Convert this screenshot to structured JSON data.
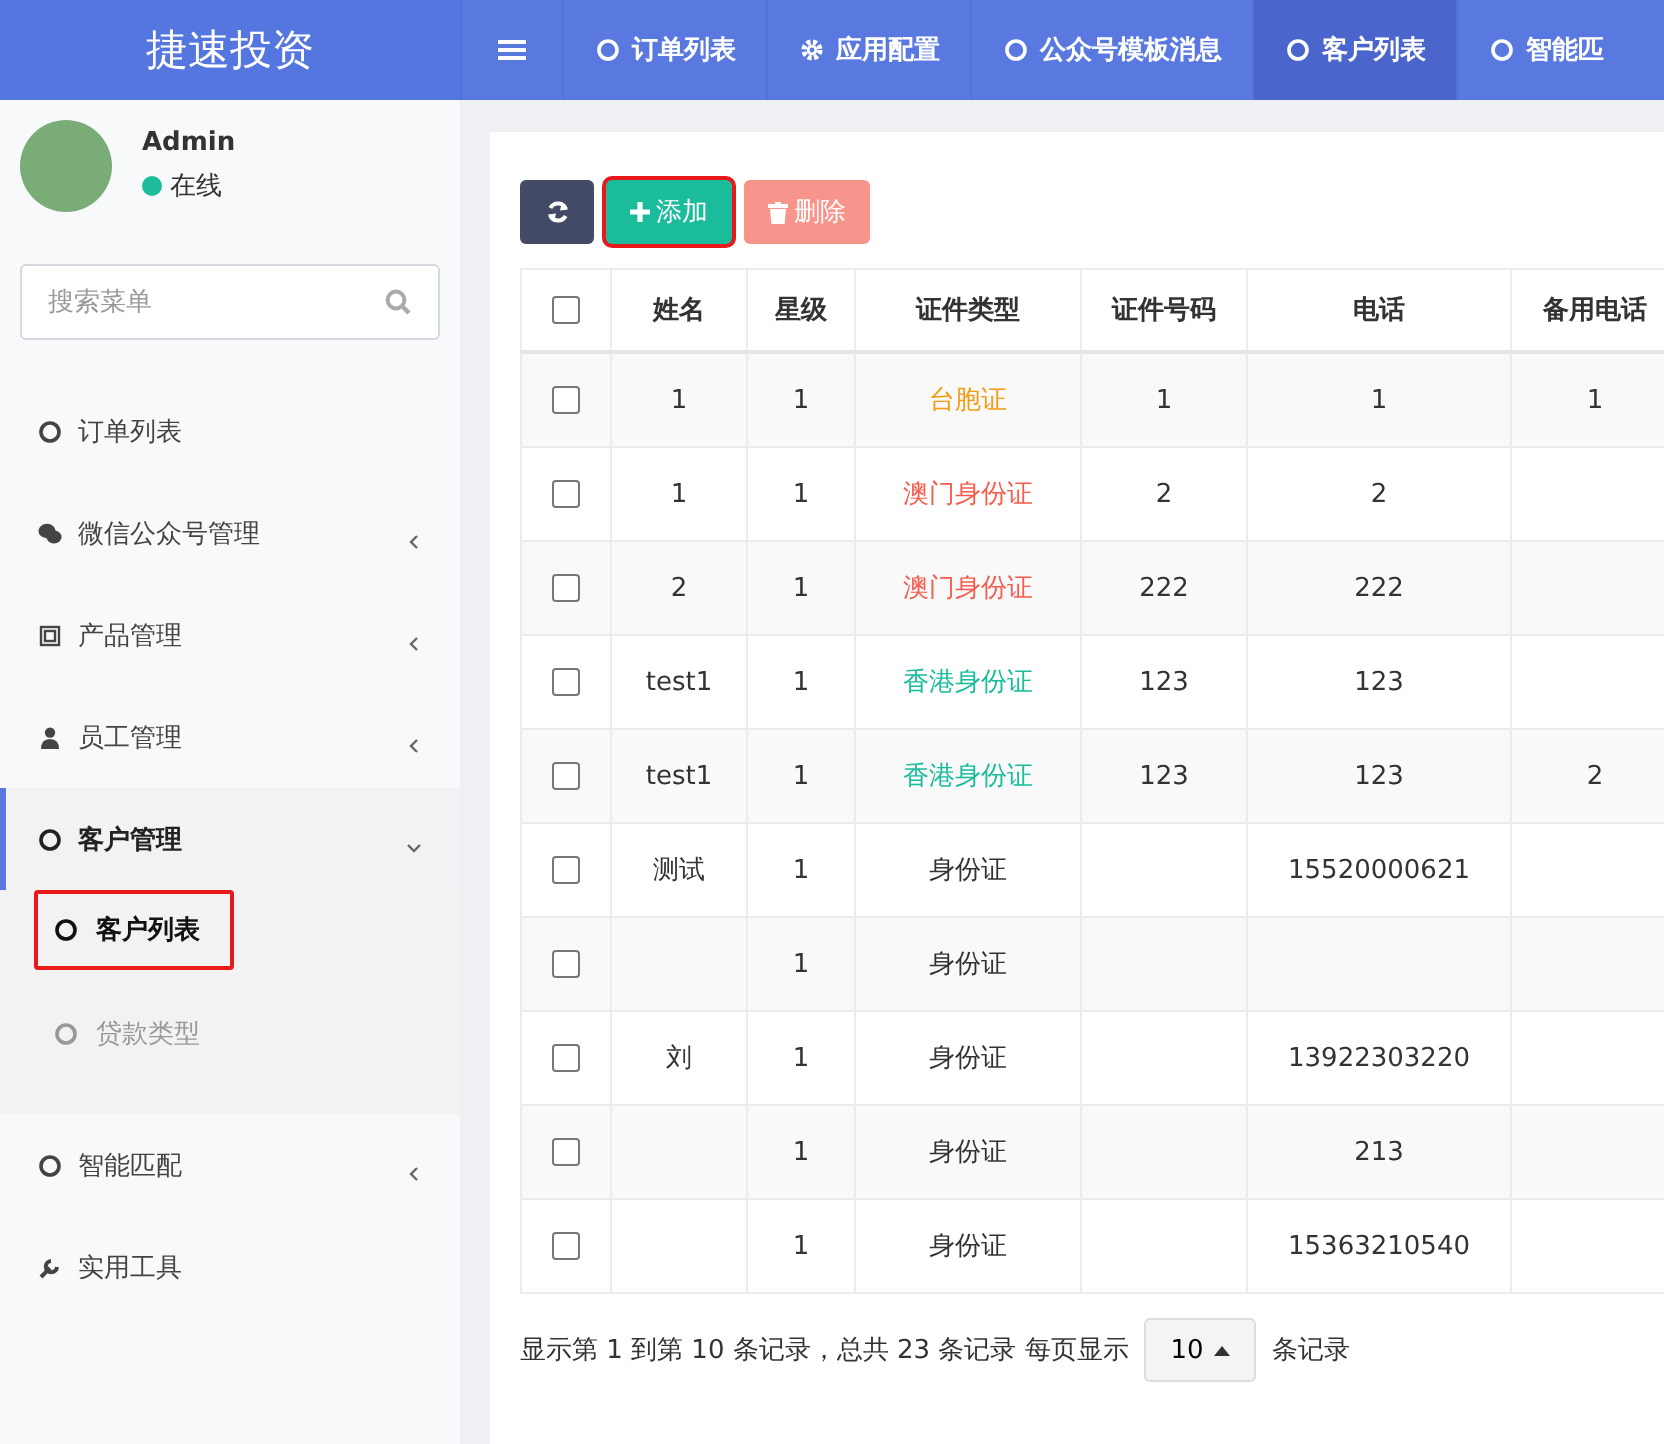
{
  "app": {
    "title": "捷速投资"
  },
  "top_nav": [
    {
      "label": "订单列表",
      "selected": false
    },
    {
      "label": "应用配置",
      "selected": false
    },
    {
      "label": "公众号模板消息",
      "selected": false
    },
    {
      "label": "客户列表",
      "selected": true
    },
    {
      "label": "智能匹",
      "selected": false
    }
  ],
  "user": {
    "name": "Admin",
    "status": "在线",
    "online": true
  },
  "search": {
    "placeholder": "搜索菜单"
  },
  "sidebar": {
    "items": [
      {
        "label": "订单列表",
        "kind": "link",
        "selected": false
      },
      {
        "label": "微信公众号管理",
        "kind": "group",
        "expanded": false,
        "selected": false
      },
      {
        "label": "产品管理",
        "kind": "group",
        "expanded": false,
        "selected": false
      },
      {
        "label": "员工管理",
        "kind": "group",
        "expanded": false,
        "selected": false
      },
      {
        "label": "客户管理",
        "kind": "group",
        "expanded": true,
        "selected": true,
        "children": [
          {
            "label": "客户列表",
            "selected": true,
            "highlighted": true
          },
          {
            "label": "贷款类型",
            "selected": false,
            "highlighted": false
          }
        ]
      },
      {
        "label": "智能匹配",
        "kind": "group",
        "expanded": false,
        "selected": false
      },
      {
        "label": "实用工具",
        "kind": "link",
        "selected": false
      }
    ]
  },
  "toolbar": {
    "add": {
      "label": "添加",
      "highlighted": true
    },
    "delete": {
      "label": "删除",
      "disabled": true
    }
  },
  "table": {
    "select_all": false,
    "columns": [
      "姓名",
      "星级",
      "证件类型",
      "证件号码",
      "电话",
      "备用电话"
    ],
    "rows": [
      {
        "checked": false,
        "name": "1",
        "level": "1",
        "id_type": {
          "text": "台胞证",
          "color": "#f39c12"
        },
        "id_number": "1",
        "phone": "1",
        "alt_phone": "1"
      },
      {
        "checked": false,
        "name": "1",
        "level": "1",
        "id_type": {
          "text": "澳门身份证",
          "color": "#f75d4f"
        },
        "id_number": "2",
        "phone": "2",
        "alt_phone": ""
      },
      {
        "checked": false,
        "name": "2",
        "level": "1",
        "id_type": {
          "text": "澳门身份证",
          "color": "#f75d4f"
        },
        "id_number": "222",
        "phone": "222",
        "alt_phone": ""
      },
      {
        "checked": false,
        "name": "test1",
        "level": "1",
        "id_type": {
          "text": "香港身份证",
          "color": "#1abc9c"
        },
        "id_number": "123",
        "phone": "123",
        "alt_phone": ""
      },
      {
        "checked": false,
        "name": "test1",
        "level": "1",
        "id_type": {
          "text": "香港身份证",
          "color": "#1abc9c"
        },
        "id_number": "123",
        "phone": "123",
        "alt_phone": "2"
      },
      {
        "checked": false,
        "name": "测试",
        "level": "1",
        "id_type": {
          "text": "身份证",
          "color": "#333333"
        },
        "id_number": "",
        "phone": "15520000621",
        "alt_phone": ""
      },
      {
        "checked": false,
        "name": "",
        "level": "1",
        "id_type": {
          "text": "身份证",
          "color": "#333333"
        },
        "id_number": "",
        "phone": "",
        "alt_phone": ""
      },
      {
        "checked": false,
        "name": "刘",
        "level": "1",
        "id_type": {
          "text": "身份证",
          "color": "#333333"
        },
        "id_number": "",
        "phone": "13922303220",
        "alt_phone": ""
      },
      {
        "checked": false,
        "name": "",
        "level": "1",
        "id_type": {
          "text": "身份证",
          "color": "#333333"
        },
        "id_number": "",
        "phone": "213",
        "alt_phone": ""
      },
      {
        "checked": false,
        "name": "",
        "level": "1",
        "id_type": {
          "text": "身份证",
          "color": "#333333"
        },
        "id_number": "",
        "phone": "15363210540",
        "alt_phone": ""
      }
    ]
  },
  "pagination": {
    "summary": "显示第 1 到第 10 条记录，总共 23 条记录 每页显示",
    "page_size": "10",
    "suffix": "条记录"
  }
}
